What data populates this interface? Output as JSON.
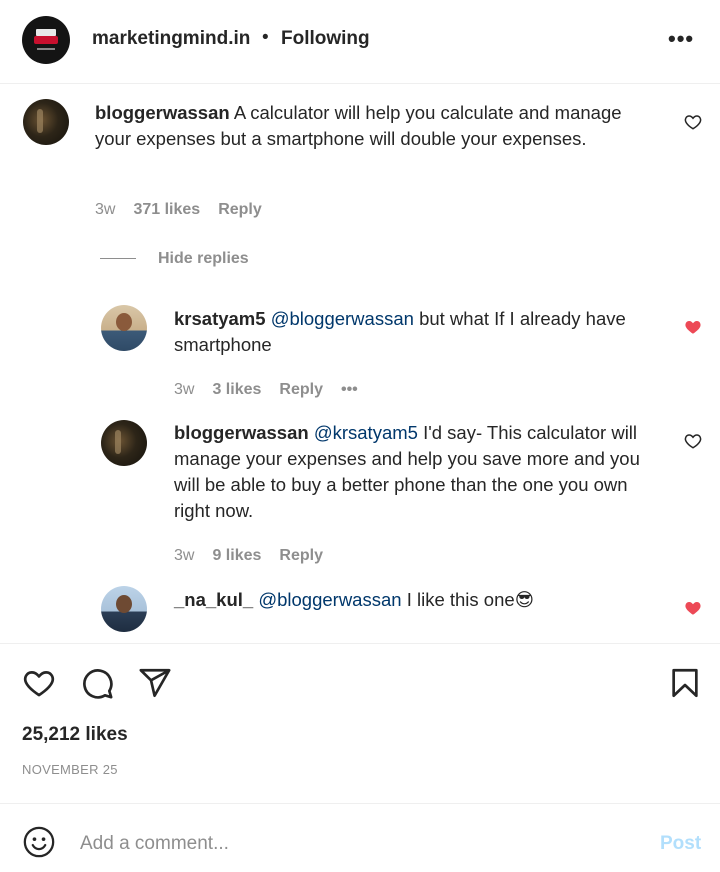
{
  "header": {
    "username": "marketingmind.in",
    "separator": "•",
    "follow_state": "Following",
    "more_label": "•••"
  },
  "comments": [
    {
      "username": "bloggerwassan",
      "text": "A calculator will help you calculate and manage your expenses but a smartphone will double your expenses.",
      "age": "3w",
      "likes": "371 likes",
      "reply": "Reply",
      "liked": false
    },
    {
      "username": "krsatyam5",
      "mention": "@bloggerwassan",
      "text": "but what If I already have smartphone",
      "age": "3w",
      "likes": "3 likes",
      "reply": "Reply",
      "more": "•••",
      "liked": true
    },
    {
      "username": "bloggerwassan",
      "mention": "@krsatyam5",
      "text": "I'd say- This calculator will manage your expenses and help you save more and you will be able to buy a better phone than the one you own right now.",
      "age": "3w",
      "likes": "9 likes",
      "reply": "Reply",
      "liked": false
    },
    {
      "username": "_na_kul_",
      "mention": "@bloggerwassan",
      "text": "I like this one",
      "emoji": "😎",
      "liked": true
    }
  ],
  "hide_replies": "Hide replies",
  "post": {
    "likes": "25,212 likes",
    "date": "NOVEMBER 25"
  },
  "add_comment": {
    "placeholder": "Add a comment...",
    "post_label": "Post"
  },
  "colors": {
    "liked_heart": "#ed4956",
    "mention": "#00376b",
    "muted": "#8e8e8e",
    "post_disabled": "#b2dffc"
  },
  "icons": [
    "heart-icon",
    "comment-icon",
    "share-icon",
    "bookmark-icon",
    "emoji-icon",
    "more-icon"
  ]
}
